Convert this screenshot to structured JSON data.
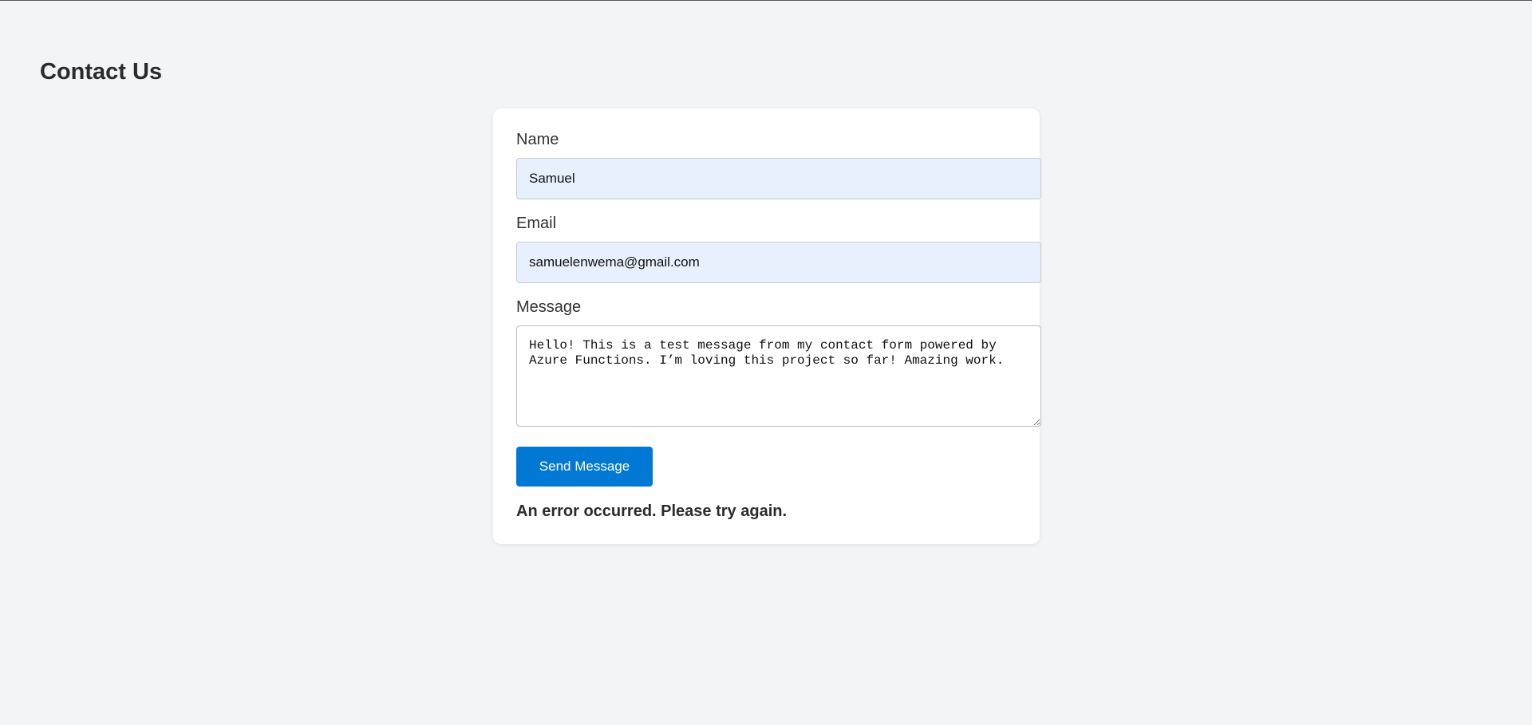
{
  "page": {
    "title": "Contact Us"
  },
  "form": {
    "name_label": "Name",
    "name_value": "Samuel",
    "email_label": "Email",
    "email_value": "samuelenwema@gmail.com",
    "message_label": "Message",
    "message_value": "Hello! This is a test message from my contact form powered by Azure Functions. I’m loving this project so far! Amazing work.",
    "submit_label": "Send Message",
    "status_message": "An error occurred. Please try again."
  },
  "colors": {
    "background": "#f3f4f6",
    "card": "#ffffff",
    "autofill_input": "#e8f0fe",
    "button": "#0078d4",
    "button_text": "#ffffff",
    "text": "#2b2b2b"
  }
}
